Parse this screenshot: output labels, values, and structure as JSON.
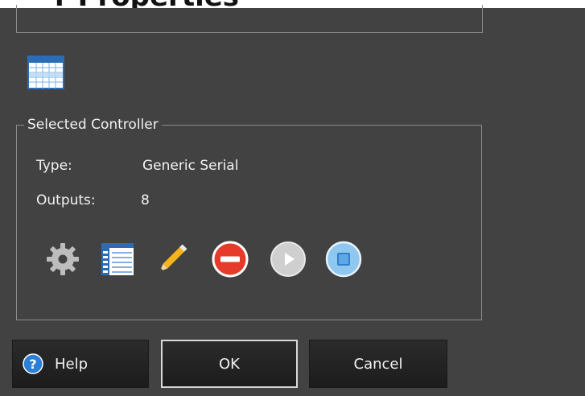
{
  "window": {
    "title_fragment": "r Properties"
  },
  "selected_controller": {
    "legend": "Selected Controller",
    "type_label": "Type:",
    "type_value": "Generic Serial",
    "outputs_label": "Outputs:",
    "outputs_value": "8"
  },
  "toolbar": {
    "icons": [
      "grid-icon",
      "gear-icon",
      "list-icon",
      "pencil-icon",
      "delete-icon",
      "play-icon",
      "stop-icon"
    ]
  },
  "buttons": {
    "help_label": "Help",
    "ok_label": "OK",
    "cancel_label": "Cancel"
  },
  "colors": {
    "background": "#424242",
    "border": "#8b8b8b",
    "delete_red": "#e63a2a",
    "stop_blue": "#8fc7ef",
    "help_blue": "#2b7fd6",
    "pencil_yellow": "#f4b41a"
  }
}
